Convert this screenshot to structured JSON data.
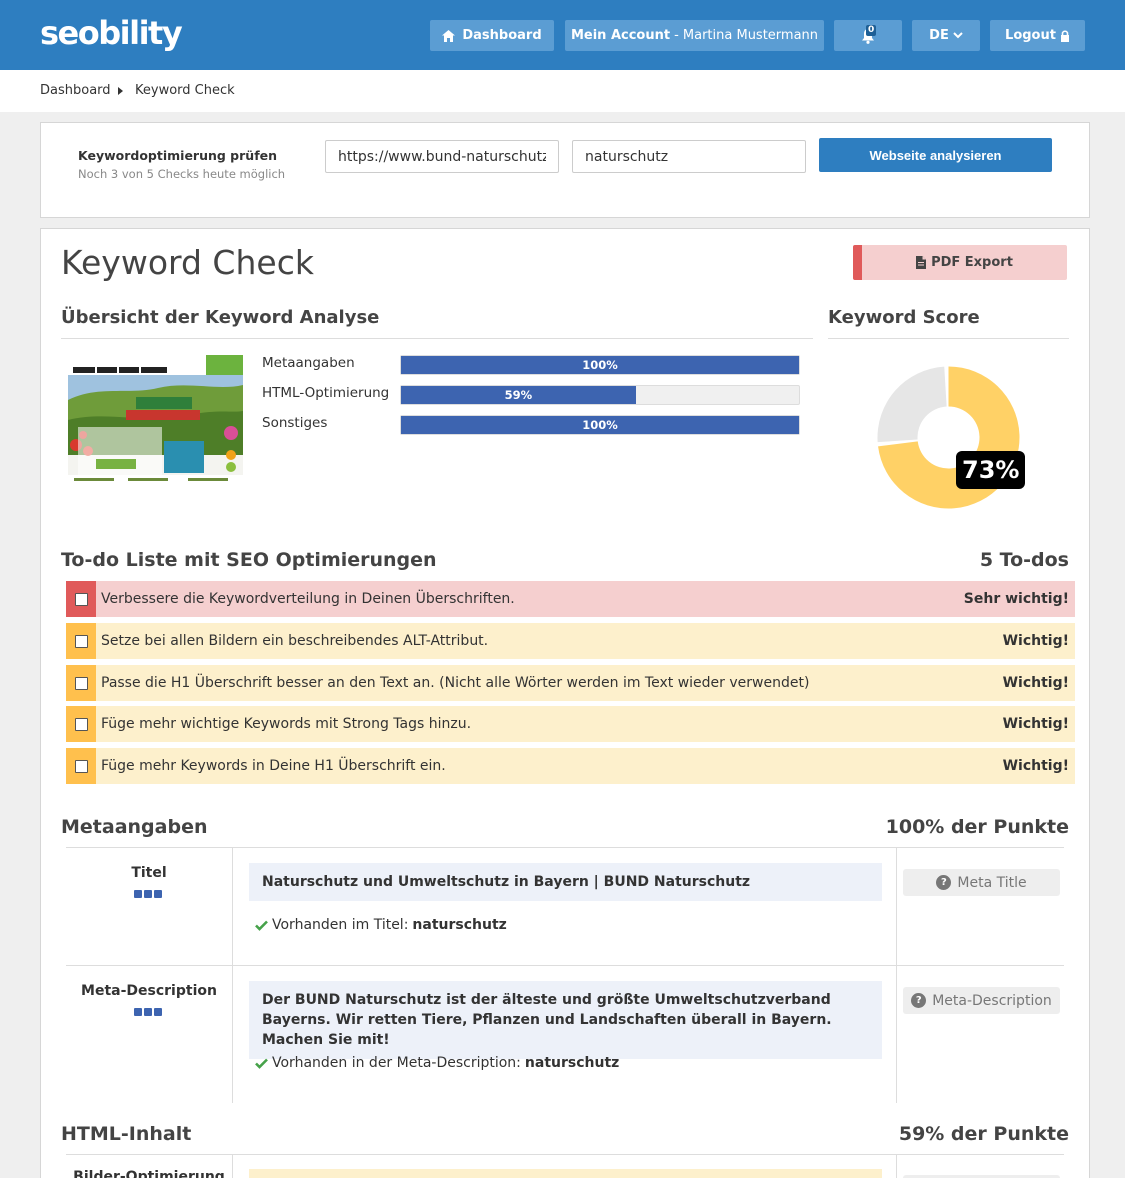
{
  "brand": {
    "logo": "seobility"
  },
  "topnav": {
    "dashboard": "Dashboard",
    "account": "Mein Account",
    "account_user": "- Martina Mustermann",
    "notifications_count": "0",
    "language": "DE",
    "logout": "Logout"
  },
  "breadcrumb": {
    "item1": "Dashboard",
    "item2": "Keyword Check"
  },
  "search": {
    "title": "Keywordoptimierung prüfen",
    "subtitle": "Noch 3 von 5 Checks heute möglich",
    "url_value": "https://www.bund-naturschutz.de",
    "keyword_value": "naturschutz",
    "submit": "Webseite analysieren"
  },
  "page": {
    "title": "Keyword Check",
    "pdf_export": "PDF Export"
  },
  "overview": {
    "heading": "Übersicht der Keyword Analyse",
    "bars": [
      {
        "label": "Metaangaben",
        "percent": 100,
        "text": "100%"
      },
      {
        "label": "HTML-Optimierung",
        "percent": 59,
        "text": "59%"
      },
      {
        "label": "Sonstiges",
        "percent": 100,
        "text": "100%"
      }
    ]
  },
  "score": {
    "heading": "Keyword Score",
    "value": 73,
    "text": "73%",
    "color": "#ffd166",
    "rest_color": "#e6e6e6"
  },
  "todos": {
    "heading": "To-do Liste mit SEO Optimierungen",
    "count": "5 To-dos",
    "items": [
      {
        "text": "Verbessere die Keywordverteilung in Deinen Überschriften.",
        "priority": "Sehr wichtig!"
      },
      {
        "text": "Setze bei allen Bildern ein beschreibendes ALT-Attribut.",
        "priority": "Wichtig!"
      },
      {
        "text": "Passe die H1 Überschrift besser an den Text an. (Nicht alle Wörter werden im Text wieder verwendet)",
        "priority": "Wichtig!"
      },
      {
        "text": "Füge mehr wichtige Keywords mit Strong Tags hinzu.",
        "priority": "Wichtig!"
      },
      {
        "text": "Füge mehr Keywords in Deine H1 Überschrift ein.",
        "priority": "Wichtig!"
      }
    ]
  },
  "meta": {
    "heading": "Metaangaben",
    "points": "100% der Punkte",
    "rows": [
      {
        "label": "Titel",
        "content": "Naturschutz und Umweltschutz in Bayern | BUND Naturschutz",
        "check_text": "Vorhanden im Titel:",
        "check_keyword": "naturschutz",
        "help": "Meta Title"
      },
      {
        "label": "Meta-Description",
        "content": "Der BUND Naturschutz ist der älteste und größte Umweltschutzverband Bayerns. Wir retten Tiere, Pflanzen und Landschaften überall in Bayern. Machen Sie mit!",
        "check_text": "Vorhanden in der Meta-Description:",
        "check_keyword": "naturschutz",
        "help": "Meta-Description"
      }
    ]
  },
  "html": {
    "heading": "HTML-Inhalt",
    "points": "59% der Punkte",
    "first_row_label": "Bilder-Optimierung"
  }
}
